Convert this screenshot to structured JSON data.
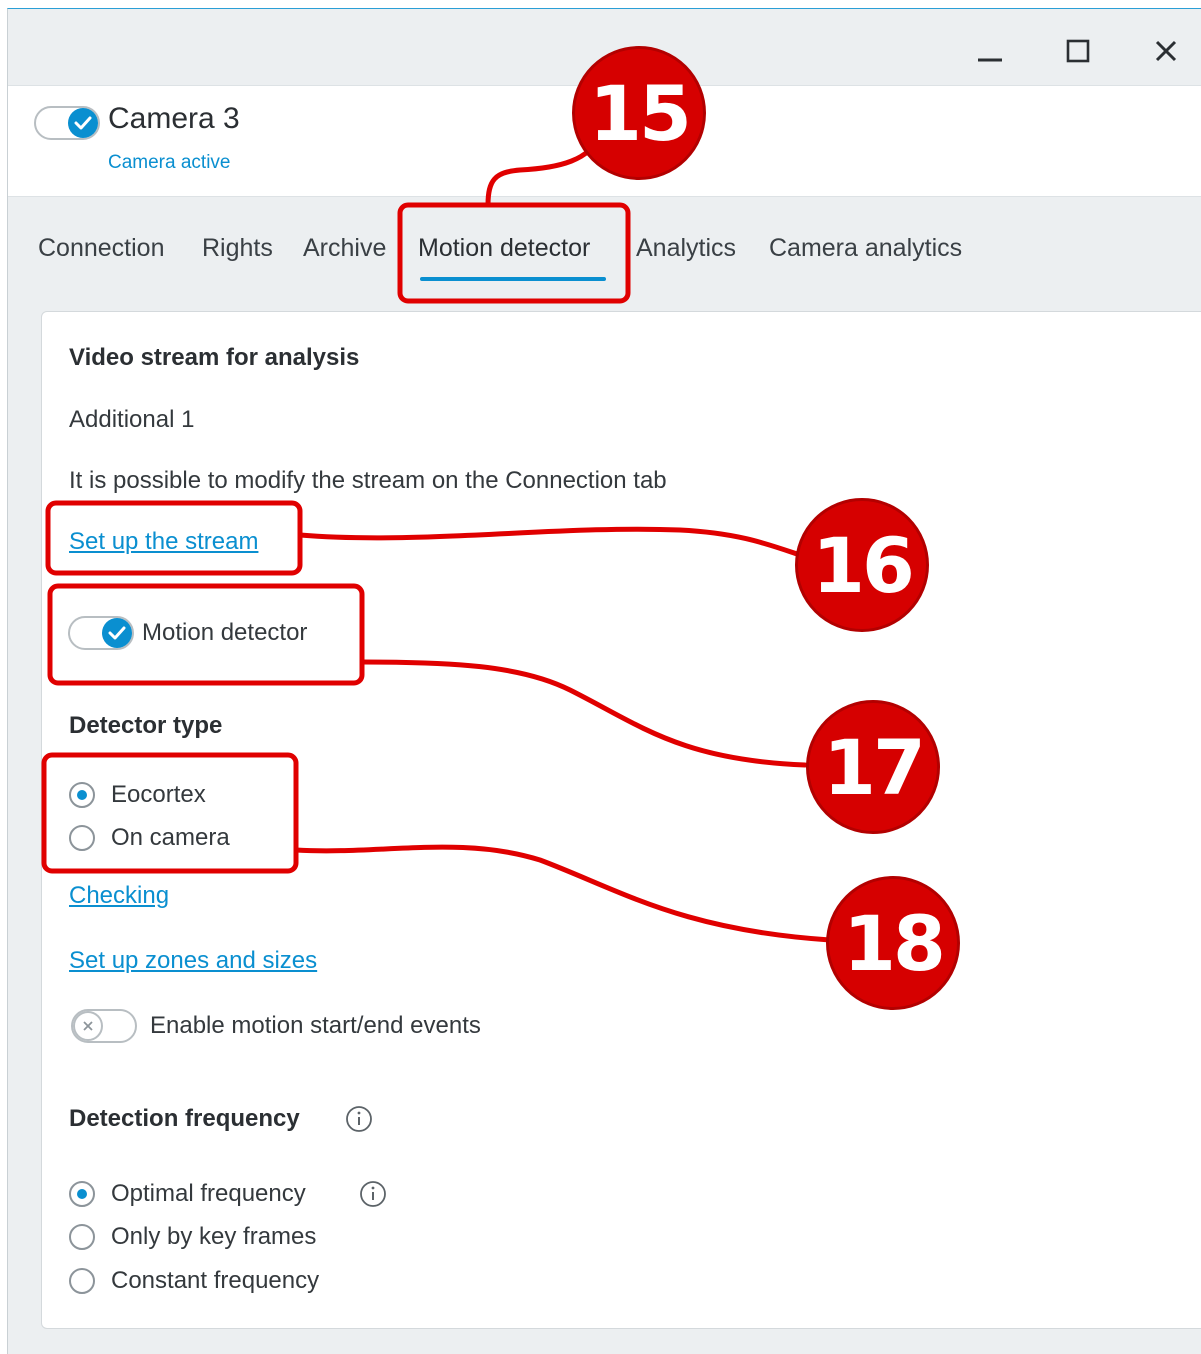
{
  "window": {
    "controls": [
      {
        "name": "minimize",
        "icon": "minimize-icon"
      },
      {
        "name": "maximize",
        "icon": "maximize-icon"
      },
      {
        "name": "close",
        "icon": "close-icon"
      }
    ]
  },
  "camera": {
    "enabled": true,
    "name": "Camera 3",
    "status": "Camera active"
  },
  "tabs": [
    {
      "label": "Connection",
      "active": false
    },
    {
      "label": "Rights",
      "active": false
    },
    {
      "label": "Archive",
      "active": false
    },
    {
      "label": "Motion detector",
      "active": true
    },
    {
      "label": "Analytics",
      "active": false
    },
    {
      "label": "Camera analytics",
      "active": false
    }
  ],
  "motion": {
    "stream_heading": "Video stream for analysis",
    "stream_value": "Additional 1",
    "stream_note": "It is possible to modify the stream on the Connection tab",
    "setup_stream_link": "Set up the stream",
    "detector_toggle_label": "Motion detector",
    "detector_enabled": true,
    "detector_type_heading": "Detector type",
    "detector_types": [
      {
        "label": "Eocortex",
        "selected": true
      },
      {
        "label": "On camera",
        "selected": false
      }
    ],
    "checking_link": "Checking",
    "zones_link": "Set up zones and sizes",
    "events_toggle_label": "Enable motion start/end events",
    "events_enabled": false,
    "frequency_heading": "Detection frequency",
    "frequency_options": [
      {
        "label": "Optimal frequency",
        "selected": true
      },
      {
        "label": "Only by key frames",
        "selected": false
      },
      {
        "label": "Constant frequency",
        "selected": false
      }
    ]
  },
  "annotations": [
    {
      "number": "15"
    },
    {
      "number": "16"
    },
    {
      "number": "17"
    },
    {
      "number": "18"
    }
  ],
  "colors": {
    "accent": "#0a8fd0",
    "annotation_red": "#d60000",
    "window_bg": "#eceff1"
  }
}
